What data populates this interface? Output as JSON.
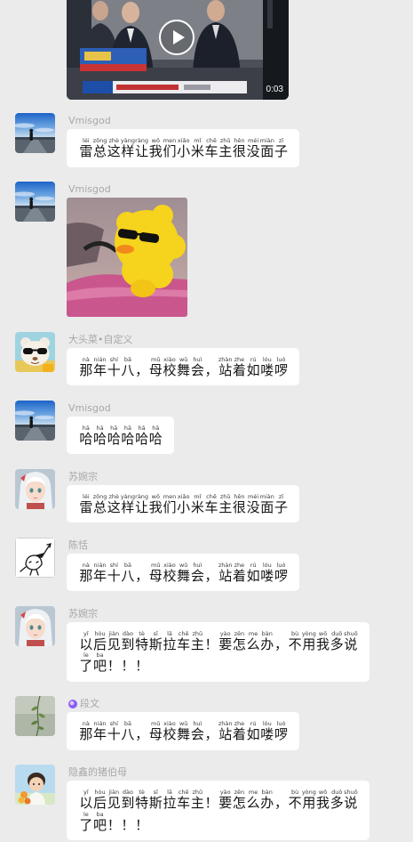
{
  "colors": {
    "background": "#ebebeb",
    "bubble": "#ffffff",
    "sender_name": "#a8a8a8",
    "hanzi": "#141414",
    "pinyin": "#3c3c3c",
    "badge": "#8b5cf6"
  },
  "video_message": {
    "duration": "0:03",
    "play_icon": "play-icon"
  },
  "messages": [
    {
      "sender": "Vmisgod",
      "avatar": "landscape-avatar",
      "lines": [
        {
          "hanzi": [
            "雷",
            "总",
            "这",
            "样",
            "让",
            "我",
            "们",
            "小",
            "米",
            "车",
            "主",
            "很",
            "没",
            "面",
            "子"
          ],
          "pinyin": [
            "léi",
            "zǒng",
            "zhè",
            "yàng",
            "ràng",
            "wǒ",
            "men",
            "xiǎo",
            "mǐ",
            "chē",
            "zhǔ",
            "hěn",
            "méi",
            "miàn",
            "zǐ"
          ]
        }
      ]
    },
    {
      "sender": "Vmisgod",
      "avatar": "landscape-avatar",
      "sticker": "duck-sticker"
    },
    {
      "sender": "大头菜•自定义",
      "avatar": "bear-sunglasses-avatar",
      "lines": [
        {
          "hanzi": [
            "那",
            "年",
            "十",
            "八",
            "，",
            "母",
            "校",
            "舞",
            "会",
            "，",
            "站",
            "着",
            "如",
            "喽",
            "啰"
          ],
          "pinyin": [
            "nà",
            "nián",
            "shí",
            "bā",
            "",
            "mǔ",
            "xiào",
            "wǔ",
            "huì",
            "",
            "zhàn",
            "zhe",
            "rú",
            "lóu",
            "luó"
          ]
        }
      ]
    },
    {
      "sender": "Vmisgod",
      "avatar": "landscape-avatar",
      "lines": [
        {
          "hanzi": [
            "哈",
            "哈",
            "哈",
            "哈",
            "哈",
            "哈"
          ],
          "pinyin": [
            "hā",
            "hā",
            "hā",
            "hā",
            "hā",
            "hā"
          ]
        }
      ]
    },
    {
      "sender": "苏婉宗",
      "avatar": "anime-girl-avatar",
      "lines": [
        {
          "hanzi": [
            "雷",
            "总",
            "这",
            "样",
            "让",
            "我",
            "们",
            "小",
            "米",
            "车",
            "主",
            "很",
            "没",
            "面",
            "子"
          ],
          "pinyin": [
            "léi",
            "zǒng",
            "zhè",
            "yàng",
            "ràng",
            "wǒ",
            "men",
            "xiǎo",
            "mǐ",
            "chē",
            "zhǔ",
            "hěn",
            "méi",
            "miàn",
            "zǐ"
          ]
        }
      ]
    },
    {
      "sender": "陈恬",
      "avatar": "doodle-avatar",
      "lines": [
        {
          "hanzi": [
            "那",
            "年",
            "十",
            "八",
            "，",
            "母",
            "校",
            "舞",
            "会",
            "，",
            "站",
            "着",
            "如",
            "喽",
            "啰"
          ],
          "pinyin": [
            "nà",
            "nián",
            "shí",
            "bā",
            "",
            "mǔ",
            "xiào",
            "wǔ",
            "huì",
            "",
            "zhàn",
            "zhe",
            "rú",
            "lóu",
            "luó"
          ]
        }
      ]
    },
    {
      "sender": "苏婉宗",
      "avatar": "anime-girl-avatar",
      "lines": [
        {
          "hanzi": [
            "以",
            "后",
            "见",
            "到",
            "特",
            "斯",
            "拉",
            "车",
            "主",
            "！",
            "要",
            "怎",
            "么",
            "办",
            "，",
            "不",
            "用",
            "我",
            "多",
            "说"
          ],
          "pinyin": [
            "yǐ",
            "hòu",
            "jiàn",
            "dào",
            "tè",
            "sī",
            "lā",
            "chē",
            "zhǔ",
            "",
            "yào",
            "zěn",
            "me",
            "bàn",
            "",
            "bù",
            "yòng",
            "wǒ",
            "duō",
            "shuō"
          ]
        },
        {
          "hanzi": [
            "了",
            "吧",
            "！",
            "！",
            "！"
          ],
          "pinyin": [
            "le",
            "ba",
            "",
            "",
            ""
          ]
        }
      ]
    },
    {
      "sender": "段文",
      "badge_icon": "purple-badge-icon",
      "avatar": "plant-avatar",
      "lines": [
        {
          "hanzi": [
            "那",
            "年",
            "十",
            "八",
            "，",
            "母",
            "校",
            "舞",
            "会",
            "，",
            "站",
            "着",
            "如",
            "喽",
            "啰"
          ],
          "pinyin": [
            "nà",
            "nián",
            "shí",
            "bā",
            "",
            "mǔ",
            "xiào",
            "wǔ",
            "huì",
            "",
            "zhàn",
            "zhe",
            "rú",
            "lóu",
            "luó"
          ]
        }
      ]
    },
    {
      "sender": "隐鑫的猪伯母",
      "avatar": "kid-flowers-avatar",
      "lines": [
        {
          "hanzi": [
            "以",
            "后",
            "见",
            "到",
            "特",
            "斯",
            "拉",
            "车",
            "主",
            "！",
            "要",
            "怎",
            "么",
            "办",
            "，",
            "不",
            "用",
            "我",
            "多",
            "说"
          ],
          "pinyin": [
            "yǐ",
            "hòu",
            "jiàn",
            "dào",
            "tè",
            "sī",
            "lā",
            "chē",
            "zhǔ",
            "",
            "yào",
            "zěn",
            "me",
            "bàn",
            "",
            "bù",
            "yòng",
            "wǒ",
            "duō",
            "shuō"
          ]
        },
        {
          "hanzi": [
            "了",
            "吧",
            "！",
            "！",
            "！"
          ],
          "pinyin": [
            "le",
            "ba",
            "",
            "",
            ""
          ]
        }
      ]
    }
  ]
}
